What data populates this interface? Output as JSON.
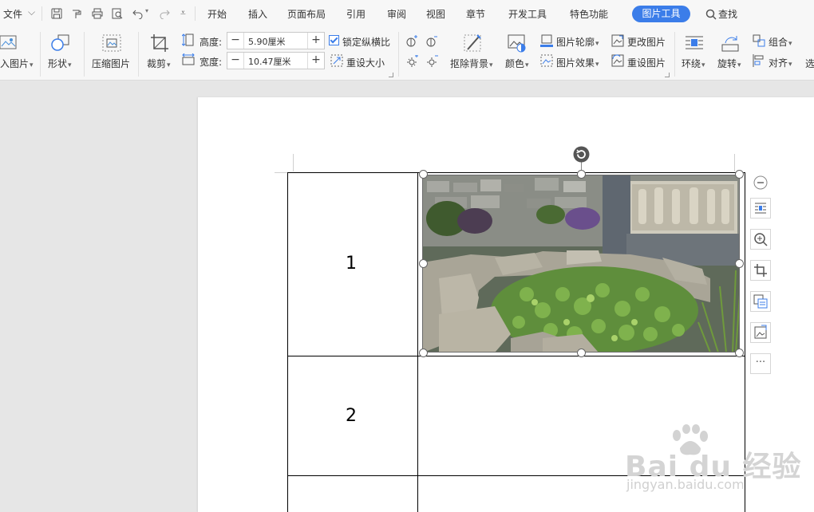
{
  "menu": {
    "file": "文件",
    "tabs": [
      "开始",
      "插入",
      "页面布局",
      "引用",
      "审阅",
      "视图",
      "章节",
      "开发工具",
      "特色功能"
    ],
    "active_tab": "图片工具",
    "search": "查找"
  },
  "ribbon": {
    "insert_picture": "入图片",
    "shape": "形状",
    "compress": "压缩图片",
    "crop": "裁剪",
    "height_label": "高度:",
    "height_value": "5.90厘米",
    "width_label": "宽度:",
    "width_value": "10.47厘米",
    "lock_ratio": "锁定纵横比",
    "reset_size": "重设大小",
    "remove_bg": "抠除背景",
    "color": "颜色",
    "outline": "图片轮廓",
    "effect": "图片效果",
    "change_picture": "更改图片",
    "reset_picture": "重设图片",
    "wrap": "环绕",
    "rotate": "旋转",
    "group": "组合",
    "align": "对齐",
    "select": "选"
  },
  "document": {
    "row1": "1",
    "row2": "2"
  },
  "side_toolbar": {
    "more": "···"
  },
  "watermark": {
    "brand": "Bai du 经验",
    "url": "jingyan.baidu.com"
  },
  "colors": {
    "accent": "#3b7de9",
    "ribbon_bg": "#f7f7f7",
    "workspace_bg": "#e6e6e6"
  }
}
